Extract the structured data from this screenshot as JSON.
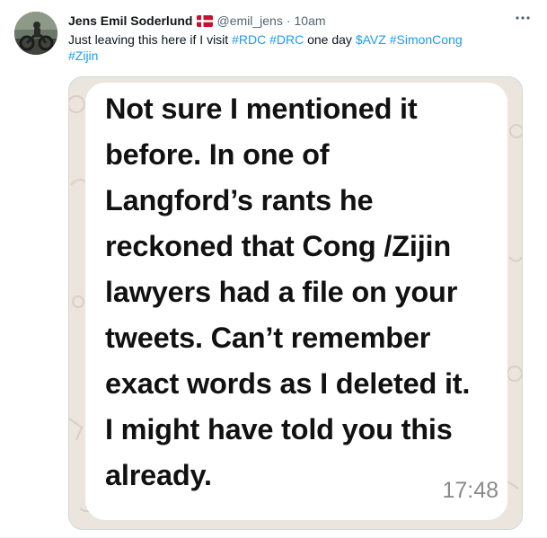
{
  "tweet": {
    "author_name": "Jens Emil Soderlund",
    "author_handle": "@emil_jens",
    "separator": "·",
    "time": "10am",
    "text_parts": {
      "intro": "Just leaving this here if I visit ",
      "tag_rdc": "#RDC",
      "tag_drc": "#DRC",
      "mid": " one day ",
      "cashtag_avz": "$AVZ",
      "tag_simoncong": "#SimonCong",
      "tag_zijin": "#Zijin"
    },
    "flag": "denmark-flag-icon",
    "more_icon": "more-options-icon"
  },
  "media": {
    "message_lines": [
      "Not sure I mentioned it",
      "before.  In one of",
      "Langford’s rants he",
      "reckoned that Cong /Zijin",
      "lawyers had a file on your",
      "tweets.  Can’t remember",
      "exact words as I deleted it.",
      "I might have told you this",
      "already."
    ],
    "message_time": "17:48"
  },
  "colors": {
    "link": "#1d9bf0",
    "secondary_text": "#536471",
    "chat_background": "#ece5dd",
    "bubble": "#ffffff"
  }
}
